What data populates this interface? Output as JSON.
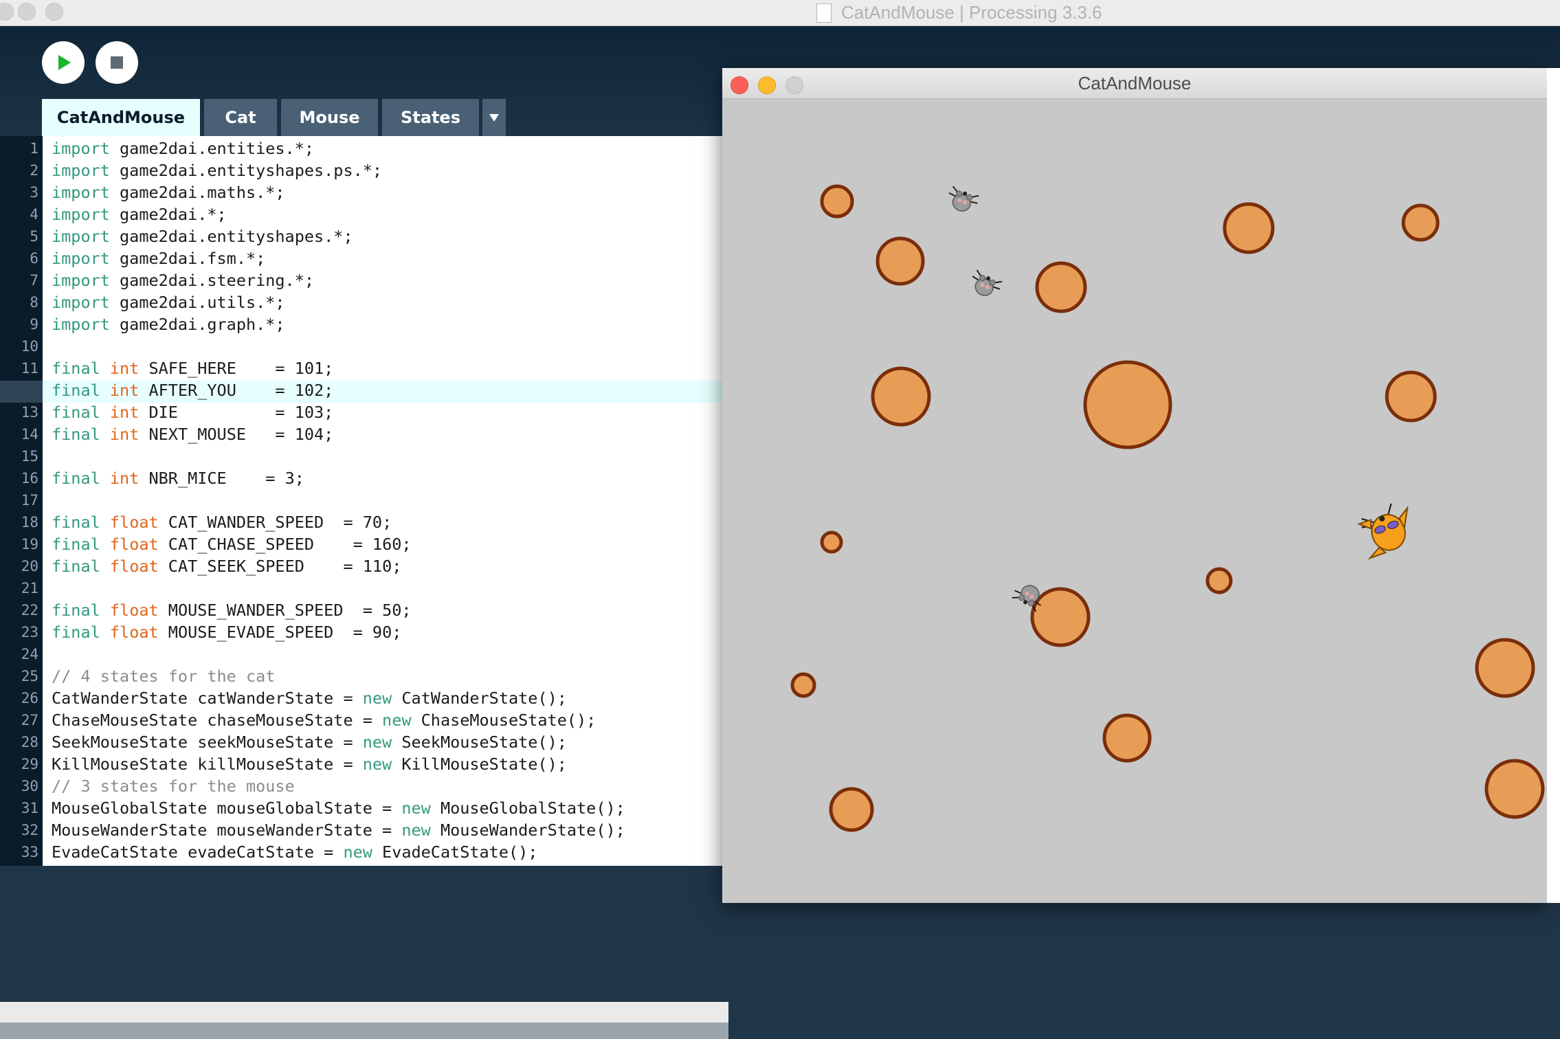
{
  "ide": {
    "title": "CatAndMouse | Processing 3.3.6",
    "tabs": [
      {
        "label": "CatAndMouse",
        "active": true
      },
      {
        "label": "Cat",
        "active": false
      },
      {
        "label": "Mouse",
        "active": false
      },
      {
        "label": "States",
        "active": false
      }
    ],
    "tab_menu_icon": "triangle-down-icon",
    "run_icon": "play-icon",
    "stop_icon": "stop-icon",
    "current_line": 12
  },
  "code_lines": [
    "import game2dai.entities.*;",
    "import game2dai.entityshapes.ps.*;",
    "import game2dai.maths.*;",
    "import game2dai.*;",
    "import game2dai.entityshapes.*;",
    "import game2dai.fsm.*;",
    "import game2dai.steering.*;",
    "import game2dai.utils.*;",
    "import game2dai.graph.*;",
    "",
    "final int SAFE_HERE    = 101;",
    "final int AFTER_YOU    = 102;",
    "final int DIE          = 103;",
    "final int NEXT_MOUSE   = 104;",
    "",
    "final int NBR_MICE    = 3;",
    "",
    "final float CAT_WANDER_SPEED  = 70;",
    "final float CAT_CHASE_SPEED    = 160;",
    "final float CAT_SEEK_SPEED    = 110;",
    "",
    "final float MOUSE_WANDER_SPEED  = 50;",
    "final float MOUSE_EVADE_SPEED  = 90;",
    "",
    "// 4 states for the cat",
    "CatWanderState catWanderState = new CatWanderState();",
    "ChaseMouseState chaseMouseState = new ChaseMouseState();",
    "SeekMouseState seekMouseState = new SeekMouseState();",
    "KillMouseState killMouseState = new KillMouseState();",
    "// 3 states for the mouse",
    "MouseGlobalState mouseGlobalState = new MouseGlobalState();",
    "MouseWanderState mouseWanderState = new MouseWanderState();",
    "EvadeCatState evadeCatState = new EvadeCatState();"
  ],
  "sketch": {
    "title": "CatAndMouse",
    "background": "#c8c8c8",
    "obstacle_fill": "#e89d57",
    "obstacle_stroke": "#7a2e0a",
    "entities": [
      "mouse",
      "mouse",
      "mouse",
      "cat"
    ]
  },
  "colors": {
    "keyword": "#33997e",
    "type": "#e2661a",
    "comment": "#8c8c8c",
    "tab_active": "#e6fffe",
    "tab_inactive": "#4a6175"
  }
}
